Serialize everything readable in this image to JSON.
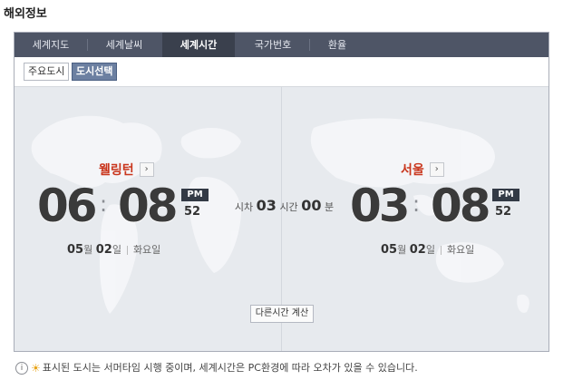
{
  "section_title": "해외정보",
  "tabs": [
    {
      "label": "세계지도",
      "active": false
    },
    {
      "label": "세계날씨",
      "active": false
    },
    {
      "label": "세계시간",
      "active": true
    },
    {
      "label": "국가번호",
      "active": false
    },
    {
      "label": "환율",
      "active": false
    }
  ],
  "subtabs": {
    "major_cities": "주요도시",
    "select_city": "도시선택"
  },
  "left_city": {
    "name": "웰링턴",
    "hour": "06",
    "minute": "08",
    "ampm": "PM",
    "second": "52",
    "month": "05",
    "month_unit": "월",
    "day": "02",
    "day_unit": "일",
    "weekday": "화요일"
  },
  "right_city": {
    "name": "서울",
    "hour": "03",
    "minute": "08",
    "ampm": "PM",
    "second": "52",
    "month": "05",
    "month_unit": "월",
    "day": "02",
    "day_unit": "일",
    "weekday": "화요일"
  },
  "time_diff": {
    "prefix": "시차",
    "hours": "03",
    "hours_unit": "시간",
    "minutes": "00",
    "minutes_unit": "분"
  },
  "calc_button": "다른시간 계산",
  "footer_text": "표시된 도시는 서머타임 시행 중이며, 세계시간은 PC환경에 따라 오차가 있을 수 있습니다.",
  "colors": {
    "tab_bar": "#4e5566",
    "active_tab": "#3a404d",
    "city_name": "#c9361d",
    "selected_subtab": "#6c80a1"
  },
  "icons": {
    "city_arrow": "chevron-right-icon",
    "footer_info": "info-icon",
    "footer_sun": "sun-icon"
  }
}
